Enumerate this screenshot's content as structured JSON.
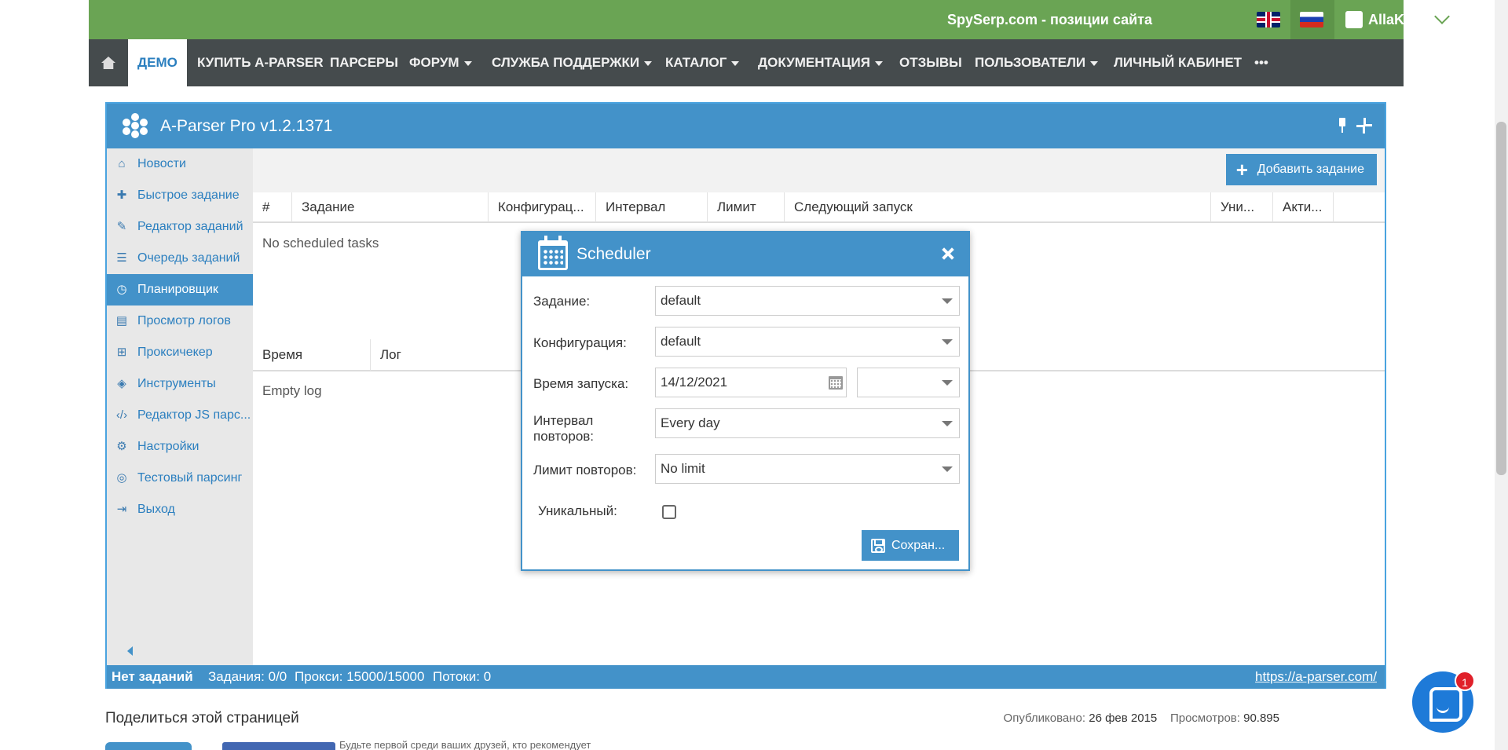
{
  "site": {
    "brand": "SpySerp.com - позиции сайта",
    "username": "AllaKuz",
    "nav": [
      "ДЕМО",
      "КУПИТЬ A-PARSER",
      "ПАРСЕРЫ",
      "ФОРУМ",
      "СЛУЖБА ПОДДЕРЖКИ",
      "КАТАЛОГ",
      "ДОКУМЕНТАЦИЯ",
      "ОТЗЫВЫ",
      "ПОЛЬЗОВАТЕЛИ",
      "ЛИЧНЫЙ КАБИНЕТ"
    ],
    "nav_more": "•••",
    "active_nav": "ДЕМО",
    "colors": {
      "topbar": "#6aa454",
      "navbar": "#454b4d",
      "accent": "#4392c9"
    }
  },
  "app": {
    "title": "A-Parser Pro v1.2.1371",
    "sidebar": [
      {
        "label": "Новости",
        "icon": "home-icon"
      },
      {
        "label": "Быстрое задание",
        "icon": "puzzle-icon"
      },
      {
        "label": "Редактор заданий",
        "icon": "edit-icon"
      },
      {
        "label": "Очередь заданий",
        "icon": "list-icon"
      },
      {
        "label": "Планировщик",
        "icon": "clock-icon",
        "active": true
      },
      {
        "label": "Просмотр логов",
        "icon": "file-icon"
      },
      {
        "label": "Проксичекер",
        "icon": "sitemap-icon"
      },
      {
        "label": "Инструменты",
        "icon": "cubes-icon"
      },
      {
        "label": "Редактор JS парс...",
        "icon": "code-icon"
      },
      {
        "label": "Настройки",
        "icon": "gears-icon"
      },
      {
        "label": "Тестовый парсинг",
        "icon": "target-icon"
      },
      {
        "label": "Выход",
        "icon": "sign-out-icon"
      }
    ],
    "add_task_label": "Добавить задание",
    "columns": [
      "#",
      "Задание",
      "Конфигурац...",
      "Интервал",
      "Лимит",
      "Следующий запуск",
      "Уни...",
      "Акти..."
    ],
    "no_tasks_text": "No scheduled tasks",
    "log_columns": [
      "Время",
      "Лог"
    ],
    "empty_log_text": "Empty log",
    "status": {
      "state": "Нет заданий",
      "tasks": "Задания: 0/0",
      "proxy": "Прокси: 15000/15000",
      "threads": "Потоки: 0",
      "link": "https://a-parser.com/"
    }
  },
  "scheduler": {
    "title": "Scheduler",
    "task_label": "Задание:",
    "task_value": "default",
    "config_label": "Конфигурация:",
    "config_value": "default",
    "start_label": "Время запуска:",
    "start_date": "14/12/2021",
    "start_time": "",
    "interval_label_1": "Интервал",
    "interval_label_2": "повторов:",
    "interval_value": "Every day",
    "limit_label": "Лимит повторов:",
    "limit_value": "No limit",
    "unique_label": "Уникальный:",
    "unique_checked": false,
    "save_label": "Сохран..."
  },
  "footer": {
    "share_title": "Поделиться этой страницей",
    "published_label": "Опубликовано:",
    "published_value": "26 фев 2015",
    "views_label": "Просмотров:",
    "views_value": "90.895",
    "fb_text": "Будьте первой среди ваших друзей, кто рекомендует"
  },
  "chat": {
    "badge": "1"
  }
}
